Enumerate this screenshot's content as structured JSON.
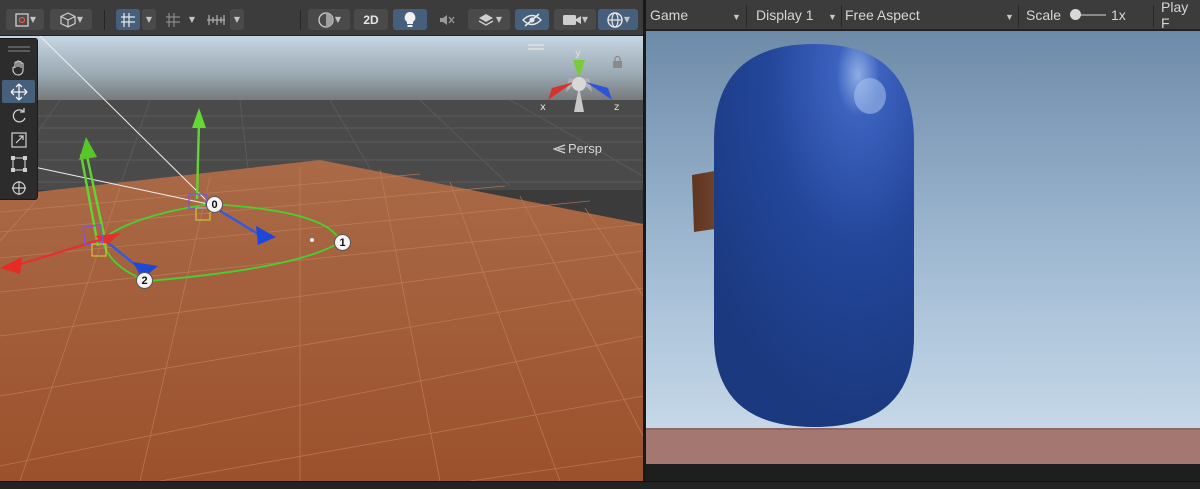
{
  "scene": {
    "toolbar": {
      "two_d_label": "2D"
    },
    "gizmo": {
      "axis_x": "x",
      "axis_y": "y",
      "axis_z": "z",
      "projection_label": "Persp"
    },
    "path_nodes": [
      "0",
      "1",
      "2"
    ]
  },
  "game": {
    "toolbar": {
      "view_label": "Game",
      "display_label": "Display 1",
      "aspect_label": "Free Aspect",
      "scale_label": "Scale",
      "scale_value": "1x",
      "play_label": "Play F"
    }
  },
  "colors": {
    "accent_selected": "#46607c",
    "ground": "#a85a32",
    "capsule": "#24479a",
    "axis_x": "#e0332f",
    "axis_y": "#62d533",
    "axis_z": "#2f5be0"
  }
}
